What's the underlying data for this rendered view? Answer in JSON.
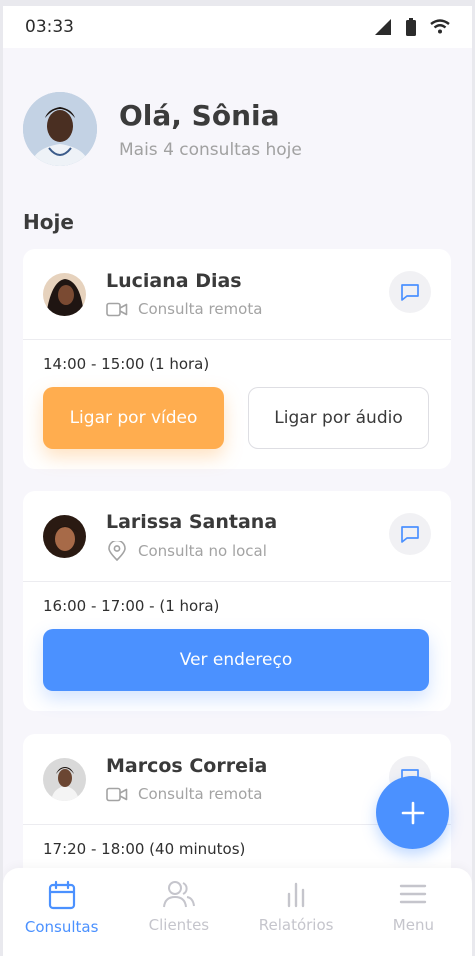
{
  "status_bar": {
    "time": "03:33"
  },
  "header": {
    "greeting": "Olá, Sônia",
    "subtitle": "Mais 4 consultas hoje"
  },
  "section_title": "Hoje",
  "appointments": [
    {
      "name": "Luciana Dias",
      "type": "Consulta remota",
      "type_icon": "video-icon",
      "time": "14:00 - 15:00 (1 hora)",
      "actions": [
        "Ligar por vídeo",
        "Ligar por áudio"
      ]
    },
    {
      "name": "Larissa Santana",
      "type": "Consulta no local",
      "type_icon": "location-icon",
      "time": "16:00 - 17:00 - (1 hora)",
      "actions": [
        "Ver endereço"
      ]
    },
    {
      "name": "Marcos Correia",
      "type": "Consulta remota",
      "type_icon": "video-icon",
      "time": "17:20 - 18:00 (40 minutos)",
      "actions": []
    }
  ],
  "bottom_nav": [
    {
      "label": "Consultas",
      "icon": "calendar-icon",
      "active": true
    },
    {
      "label": "Clientes",
      "icon": "users-icon",
      "active": false
    },
    {
      "label": "Relatórios",
      "icon": "bar-chart-icon",
      "active": false
    },
    {
      "label": "Menu",
      "icon": "menu-icon",
      "active": false
    }
  ],
  "colors": {
    "primary": "#4b91ff",
    "video_button": "#ffad4f",
    "background": "#f7f6fb"
  }
}
